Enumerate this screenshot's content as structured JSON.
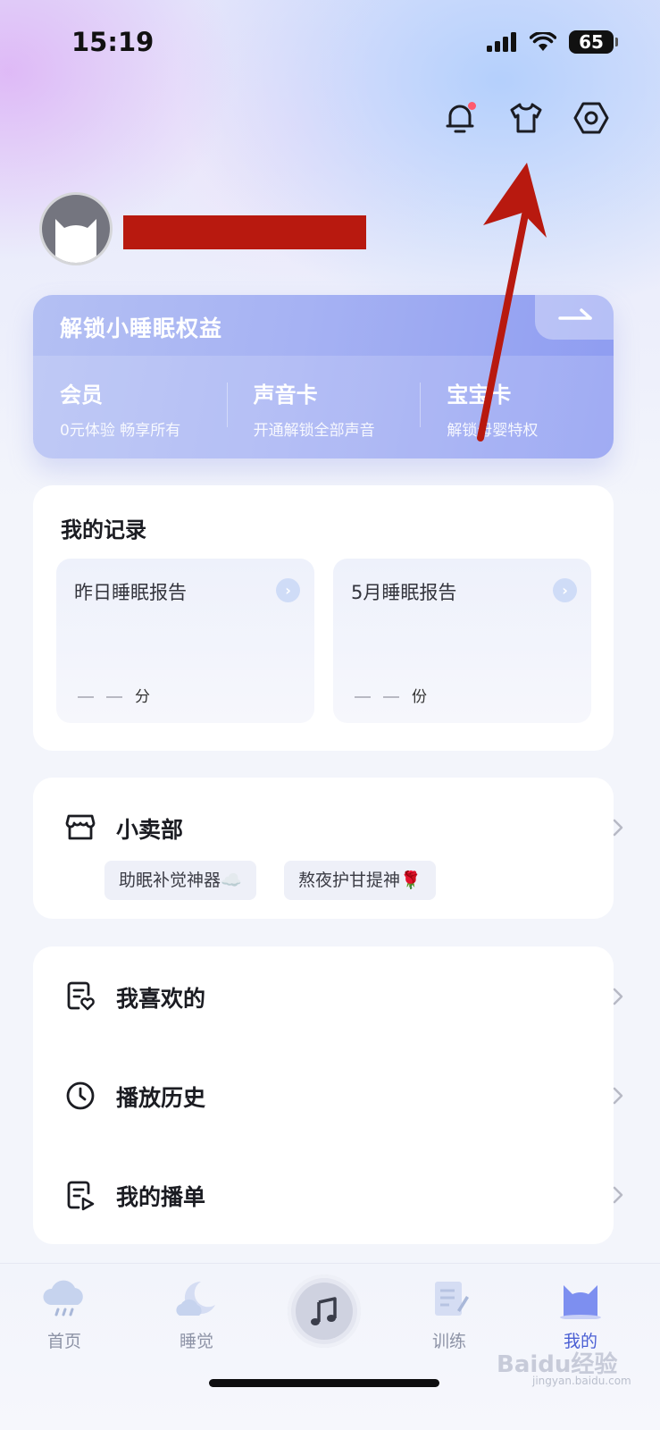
{
  "status_bar": {
    "time": "15:19",
    "battery": "65"
  },
  "header": {
    "icons": [
      "bell-icon",
      "tshirt-icon",
      "settings-icon"
    ],
    "notification_dot_color": "#ff5a6e"
  },
  "vip": {
    "title": "解锁小睡眠权益",
    "items": [
      {
        "title": "会员",
        "subtitle": "0元体验 畅享所有"
      },
      {
        "title": "声音卡",
        "subtitle": "开通解锁全部声音"
      },
      {
        "title": "宝宝卡",
        "subtitle": "解锁母婴特权"
      }
    ]
  },
  "records": {
    "title": "我的记录",
    "reports": [
      {
        "title": "昨日睡眠报告",
        "unit": "分"
      },
      {
        "title": "5月睡眠报告",
        "unit": "份"
      }
    ]
  },
  "shop": {
    "title": "小卖部",
    "tags": [
      "助眠补觉神器☁️",
      "熬夜护甘提神🌹"
    ]
  },
  "menu": {
    "items": [
      {
        "label": "我喜欢的",
        "icon": "favorite-list-icon"
      },
      {
        "label": "播放历史",
        "icon": "clock-icon"
      },
      {
        "label": "我的播单",
        "icon": "playlist-icon"
      }
    ]
  },
  "tabbar": {
    "tabs": [
      {
        "label": "首页",
        "icon": "rain-cloud-icon"
      },
      {
        "label": "睡觉",
        "icon": "moon-cloud-icon"
      },
      {
        "label": "",
        "icon": "music-note-icon"
      },
      {
        "label": "训练",
        "icon": "notebook-icon"
      },
      {
        "label": "我的",
        "icon": "cat-avatar-icon"
      }
    ],
    "active_color": "#4a5fd4"
  },
  "watermark": {
    "text": "Baidu经验",
    "sub": "jingyan.baidu.com"
  },
  "colors": {
    "annotation_arrow": "#b8190f",
    "redaction": "#b8190f"
  }
}
